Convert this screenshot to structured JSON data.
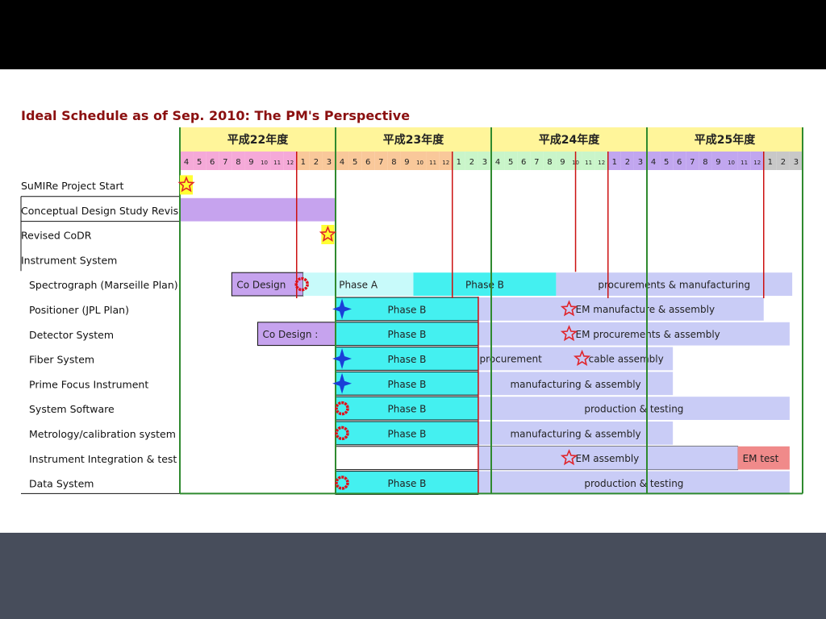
{
  "title": "Ideal Schedule as of Sep. 2010: The PM's Perspective",
  "colors": {
    "year_header": "#fff59a",
    "phase_b": "#44f0f0",
    "phase_a": "#c8fafa",
    "procurement": "#c9ccf6",
    "co_design": "#c6a3ee",
    "em_test": "#f08a8a",
    "year_line": "#2f8a2f",
    "fy_line": "#cc1111",
    "star": "#e0242a",
    "star_bg": "#ffff33",
    "circle": "#e0101a",
    "cross": "#1a3fd8"
  },
  "years": [
    {
      "label": "平成22年度"
    },
    {
      "label": "平成23年度"
    },
    {
      "label": "平成24年度"
    },
    {
      "label": "平成25年度"
    }
  ],
  "month_labels": [
    "4",
    "5",
    "6",
    "7",
    "8",
    "9",
    "10",
    "11",
    "12",
    "1",
    "2",
    "3"
  ],
  "month_colors": {
    "y22": [
      "#f5a9d8",
      "#f5a9d8",
      "#f5a9d8",
      "#f5a9d8",
      "#f5a9d8",
      "#f5a9d8",
      "#f5a9d8",
      "#f5a9d8",
      "#f5a9d8",
      "#f9c89a",
      "#f9c89a",
      "#f9c89a"
    ],
    "y23": [
      "#f9c89a",
      "#f9c89a",
      "#f9c89a",
      "#f9c89a",
      "#f9c89a",
      "#f9c89a",
      "#f9c89a",
      "#f9c89a",
      "#f9c89a",
      "#c9f5c9",
      "#c9f5c9",
      "#c9f5c9"
    ],
    "y24": [
      "#c9f5c9",
      "#c9f5c9",
      "#c9f5c9",
      "#c9f5c9",
      "#c9f5c9",
      "#c9f5c9",
      "#c9f5c9",
      "#c9f5c9",
      "#c9f5c9",
      "#c1a6ef",
      "#c1a6ef",
      "#c1a6ef"
    ],
    "y25": [
      "#c1a6ef",
      "#c1a6ef",
      "#c1a6ef",
      "#c1a6ef",
      "#c1a6ef",
      "#c1a6ef",
      "#c1a6ef",
      "#c1a6ef",
      "#c1a6ef",
      "#c8c8c8",
      "#c8c8c8",
      "#c8c8c8"
    ]
  },
  "rows": [
    {
      "label": "SuMIRe Project Start",
      "indent": 0
    },
    {
      "label": "Conceptual Design Study Revision",
      "indent": 0
    },
    {
      "label": "Revised CoDR",
      "indent": 0
    },
    {
      "label": "Instrument System",
      "indent": 0
    },
    {
      "label": "Spectrograph (Marseille Plan)",
      "indent": 1
    },
    {
      "label": "Positioner (JPL Plan)",
      "indent": 1
    },
    {
      "label": "Detector System",
      "indent": 1
    },
    {
      "label": "Fiber System",
      "indent": 1
    },
    {
      "label": "Prime Focus Instrument",
      "indent": 1
    },
    {
      "label": "System Software",
      "indent": 1
    },
    {
      "label": "Metrology/calibration system",
      "indent": 1
    },
    {
      "label": "Instrument Integration & test",
      "indent": 1
    },
    {
      "label": "Data System",
      "indent": 1
    }
  ],
  "bars": [
    {
      "row": 1,
      "start": 0,
      "end": 12,
      "color": "co_design",
      "label": "",
      "border": false
    },
    {
      "row": 4,
      "start": 4,
      "end": 9.5,
      "color": "co_design",
      "label": "Co Design",
      "align": "left",
      "border": true
    },
    {
      "row": 4,
      "start": 9.5,
      "end": 18,
      "color": "phase_a",
      "label": "Phase A",
      "align": "center",
      "border": false
    },
    {
      "row": 4,
      "start": 18,
      "end": 29,
      "color": "phase_b",
      "label": "Phase B",
      "align": "center",
      "border": false
    },
    {
      "row": 4,
      "start": 29,
      "end": 47.2,
      "color": "procurement",
      "label": "procurements & manufacturing",
      "align": "center",
      "border": false
    },
    {
      "row": 5,
      "start": 12,
      "end": 23,
      "color": "phase_b",
      "label": "Phase B",
      "align": "center",
      "border": true
    },
    {
      "row": 5,
      "start": 23,
      "end": 45,
      "color": "procurement",
      "label": "",
      "border": false
    },
    {
      "row": 6,
      "start": 6,
      "end": 12,
      "color": "co_design",
      "label": "Co Design :",
      "align": "left",
      "border": true
    },
    {
      "row": 6,
      "start": 12,
      "end": 23,
      "color": "phase_b",
      "label": "Phase B",
      "align": "center",
      "border": true
    },
    {
      "row": 6,
      "start": 23,
      "end": 47,
      "color": "procurement",
      "label": "",
      "border": false
    },
    {
      "row": 7,
      "start": 12,
      "end": 23,
      "color": "phase_b",
      "label": "Phase B",
      "align": "center",
      "border": true
    },
    {
      "row": 7,
      "start": 23,
      "end": 38,
      "color": "procurement",
      "label": "",
      "border": false
    },
    {
      "row": 8,
      "start": 12,
      "end": 23,
      "color": "phase_b",
      "label": "Phase B",
      "align": "center",
      "border": true
    },
    {
      "row": 8,
      "start": 23,
      "end": 38,
      "color": "procurement",
      "label": "manufacturing & assembly",
      "align": "center",
      "border": false
    },
    {
      "row": 9,
      "start": 12,
      "end": 23,
      "color": "phase_b",
      "label": "Phase B",
      "align": "center",
      "border": true
    },
    {
      "row": 9,
      "start": 23,
      "end": 47,
      "color": "procurement",
      "label": "production & testing",
      "align": "center",
      "border": false
    },
    {
      "row": 10,
      "start": 12,
      "end": 23,
      "color": "phase_b",
      "label": "Phase B",
      "align": "center",
      "border": true
    },
    {
      "row": 10,
      "start": 23,
      "end": 38,
      "color": "procurement",
      "label": "manufacturing & assembly",
      "align": "center",
      "border": false
    },
    {
      "row": 11,
      "start": 12,
      "end": 43,
      "color": "none",
      "label": "",
      "border": true
    },
    {
      "row": 11,
      "start": 23,
      "end": 43,
      "color": "procurement",
      "label": "",
      "border": false
    },
    {
      "row": 11,
      "start": 43,
      "end": 47,
      "color": "em_test",
      "label": "EM test",
      "align": "left",
      "border": false
    },
    {
      "row": 12,
      "start": 12,
      "end": 23,
      "color": "phase_b",
      "label": "Phase B",
      "align": "center",
      "border": true
    },
    {
      "row": 12,
      "start": 23,
      "end": 47,
      "color": "procurement",
      "label": "production & testing",
      "align": "center",
      "border": false
    }
  ],
  "annotations": [
    {
      "row": 5,
      "at": 30.5,
      "text": "EM  manufacture & assembly"
    },
    {
      "row": 6,
      "at": 30.5,
      "text": "EM  procurements & assembly"
    },
    {
      "row": 7,
      "at": 23.1,
      "text": "procurement"
    },
    {
      "row": 7,
      "at": 31.5,
      "text": "cable assembly"
    },
    {
      "row": 11,
      "at": 30.5,
      "text": "EM assembly"
    }
  ],
  "markers": [
    {
      "row": 0,
      "at": 0.5,
      "type": "star",
      "bg": true
    },
    {
      "row": 2,
      "at": 11.4,
      "type": "star",
      "bg": true
    },
    {
      "row": 4,
      "at": 9.4,
      "type": "circle"
    },
    {
      "row": 5,
      "at": 12.5,
      "type": "cross"
    },
    {
      "row": 5,
      "at": 30.0,
      "type": "star",
      "bg": false
    },
    {
      "row": 6,
      "at": 30.0,
      "type": "star",
      "bg": false
    },
    {
      "row": 7,
      "at": 12.5,
      "type": "cross"
    },
    {
      "row": 7,
      "at": 31.0,
      "type": "star",
      "bg": false
    },
    {
      "row": 8,
      "at": 12.5,
      "type": "cross"
    },
    {
      "row": 9,
      "at": 12.5,
      "type": "circle"
    },
    {
      "row": 10,
      "at": 12.5,
      "type": "circle"
    },
    {
      "row": 11,
      "at": 30.0,
      "type": "star",
      "bg": false
    },
    {
      "row": 12,
      "at": 12.5,
      "type": "circle"
    }
  ]
}
